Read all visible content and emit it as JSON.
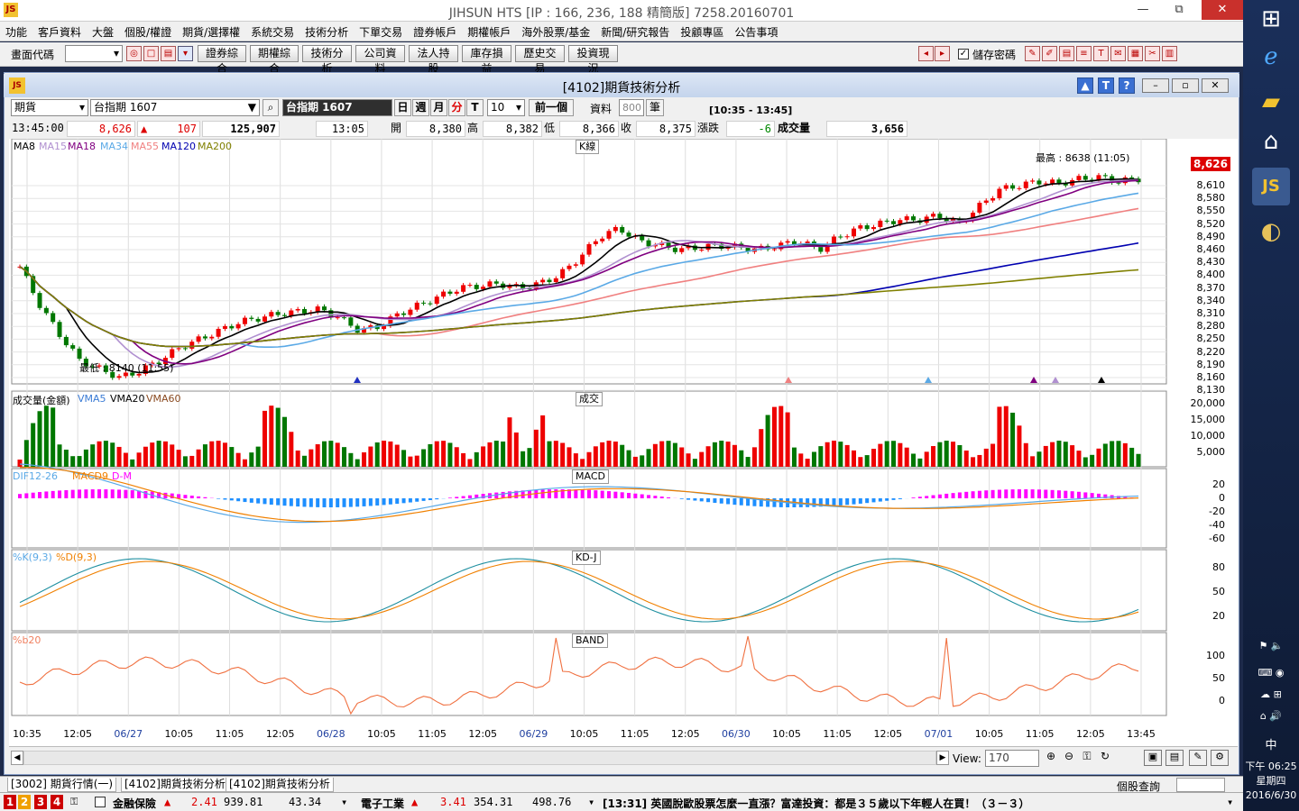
{
  "window": {
    "title": "JIHSUN HTS     [IP : 166, 236, 188 精簡版] 7258.20160701",
    "min": "—",
    "max": "⧉",
    "close": "✕"
  },
  "menu": [
    "功能",
    "客戶資料",
    "大盤",
    "個股/權證",
    "期貨/選擇權",
    "系統交易",
    "技術分析",
    "下單交易",
    "證券帳戶",
    "期權帳戶",
    "海外股票/基金",
    "新聞/研究報告",
    "投顧專區",
    "公告事項"
  ],
  "toolbar": {
    "code_label": "畫面代碼",
    "buttons": [
      "證券綜合",
      "期權綜合",
      "技術分析",
      "公司資料",
      "法人持股",
      "庫存損益",
      "歷史交易",
      "投資現況"
    ],
    "save_pw_label": "儲存密碼"
  },
  "inner": {
    "title": "[4102]期貨技術分析",
    "help": "?",
    "t": "T",
    "up": "▲"
  },
  "controls": {
    "market": "期貨",
    "symbol": "台指期 1607",
    "symbol_name": "台指期 1607",
    "periods": [
      "日",
      "週",
      "月",
      "分",
      "T"
    ],
    "interval": "10",
    "prev": "前一個",
    "data_label": "資料",
    "count": "800",
    "unit": "筆",
    "range": "[10:35 - 13:45]"
  },
  "quote": {
    "time": "13:45:00",
    "price": "8,626",
    "change_arrow": "▲",
    "change": "107",
    "volume_total": "125,907",
    "last_time": "13:05",
    "open_label": "開",
    "open": "8,380",
    "high_label": "高",
    "high": "8,382",
    "low_label": "低",
    "low": "8,366",
    "close_label": "收",
    "close": "8,375",
    "chg_label": "漲跌",
    "chg": "-6",
    "vol_label": "成交量",
    "vol": "3,656"
  },
  "panels": {
    "k": {
      "caption": "K線",
      "ma_labels": [
        "MA8",
        "MA15",
        "MA18",
        "MA34",
        "MA55",
        "MA120",
        "MA200"
      ],
      "ma_colors": [
        "#000000",
        "#b090d0",
        "#800080",
        "#5aa9e6",
        "#f08080",
        "#0000b0",
        "#808000"
      ],
      "y_ticks": [
        "8,610",
        "8,580",
        "8,550",
        "8,520",
        "8,490",
        "8,460",
        "8,430",
        "8,400",
        "8,370",
        "8,340",
        "8,310",
        "8,280",
        "8,250",
        "8,220",
        "8,190",
        "8,160",
        "8,130"
      ],
      "last_price": "8,626",
      "high_note": "最高 : 8638 (11:05)",
      "low_note": "最低 : 8140 (11:55)"
    },
    "vol": {
      "caption": "成交",
      "title": "成交量(金額)",
      "ma_labels": [
        "VMA5",
        "VMA20",
        "VMA60"
      ],
      "y_ticks": [
        "20,000",
        "15,000",
        "10,000",
        "5,000"
      ]
    },
    "macd": {
      "caption": "MACD",
      "labels": [
        "DIF12-26",
        "MACD9",
        "D-M"
      ],
      "y_ticks": [
        "20",
        "0",
        "-20",
        "-40",
        "-60"
      ]
    },
    "kd": {
      "caption": "KD-J",
      "labels": [
        "%K(9,3)",
        "%D(9,3)"
      ],
      "y_ticks": [
        "80",
        "50",
        "20"
      ]
    },
    "band": {
      "caption": "BAND",
      "labels": [
        "%b20"
      ],
      "y_ticks": [
        "100",
        "50",
        "0"
      ]
    }
  },
  "x_ticks": [
    "10:35",
    "12:05",
    "06/27",
    "10:05",
    "11:05",
    "12:05",
    "06/28",
    "10:05",
    "11:05",
    "12:05",
    "06/29",
    "10:05",
    "11:05",
    "12:05",
    "06/30",
    "10:05",
    "11:05",
    "12:05",
    "07/01",
    "10:05",
    "11:05",
    "12:05",
    "13:45"
  ],
  "scroll": {
    "view_label": "View:",
    "view_value": "170"
  },
  "tabs": [
    "[3002] 期貨行情(一)",
    "[4102]期貨技術分析",
    "[4102]期貨技術分析"
  ],
  "stock_query": "個股查詢",
  "ticker": {
    "nums": [
      "1",
      "2",
      "3",
      "4"
    ],
    "i1_name": "金融保險",
    "i1_arrow": "▲",
    "i1_chg": "2.41",
    "i1_val": "939.81",
    "i1_vol": "43.34",
    "i2_name": "電子工業",
    "i2_arrow": "▲",
    "i2_chg": "3.41",
    "i2_val": "354.31",
    "i2_vol": "498.76",
    "news": "[13:31] 英國脫歐股票怎麼一直漲？富達投資：都是３５歲以下年輕人在買！（３－３）"
  },
  "taskbar": {
    "ime": "中",
    "time": "下午 06:25",
    "day": "星期四",
    "date": "2016/6/30"
  }
}
